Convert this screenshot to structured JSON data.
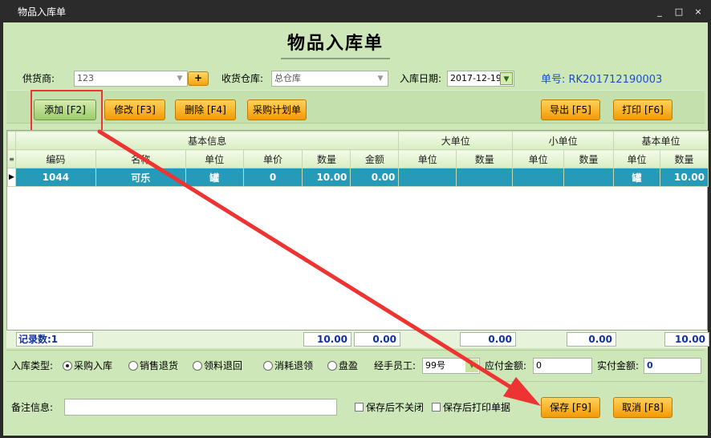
{
  "window": {
    "title": "物品入库单",
    "controls": [
      "_",
      "□",
      "×"
    ]
  },
  "form": {
    "heading": "物品入库单",
    "supplier_label": "供货商:",
    "supplier_value": "123",
    "add_supplier_label": "+",
    "warehouse_label": "收货仓库:",
    "warehouse_value": "总仓库",
    "date_label": "入库日期:",
    "date_value": "2017-12-19",
    "order_no": "单号: RK201712190003"
  },
  "toolbar": {
    "add": "添加 [F2]",
    "edit": "修改 [F3]",
    "delete": "删除 [F4]",
    "purchase_plan": "采购计划单",
    "export": "导出 [F5]",
    "print": "打印 [F6]"
  },
  "grid": {
    "groups": [
      "基本信息",
      "大单位",
      "小单位",
      "基本单位"
    ],
    "columns": [
      "编码",
      "名称",
      "单位",
      "单价",
      "数量",
      "金额",
      "单位",
      "数量",
      "单位",
      "数量",
      "单位",
      "数量"
    ],
    "rows": [
      [
        "1044",
        "可乐",
        "罐",
        "0",
        "10.00",
        "0.00",
        "",
        "",
        "",
        "",
        "罐",
        "10.00"
      ]
    ],
    "record_count": "记录数:1",
    "totals": {
      "qty": "10.00",
      "amount": "0.00",
      "big_qty": "0.00",
      "small_qty": "0.00",
      "base_qty": "10.00"
    }
  },
  "options": {
    "type_label": "入库类型:",
    "types": [
      {
        "label": "采购入库",
        "selected": true
      },
      {
        "label": "销售退货",
        "selected": false
      },
      {
        "label": "领料退回",
        "selected": false
      },
      {
        "label": "消耗退领",
        "selected": false
      },
      {
        "label": "盘盈",
        "selected": false
      }
    ],
    "operator_label": "经手员工:",
    "operator_value": "99号",
    "payable_label": "应付金额:",
    "payable_value": "0",
    "paid_label": "实付金额:",
    "paid_value": "0"
  },
  "bottom": {
    "note_label": "备注信息:",
    "note_value": "",
    "keep_open_label": "保存后不关闭",
    "print_after_label": "保存后打印单据",
    "save": "保存 [F9]",
    "cancel": "取消 [F8]"
  },
  "colors": {
    "selected_row": "#259ab9",
    "panel": "#cde7b8",
    "button": "#f29a06",
    "annotation": "#ee3333"
  }
}
